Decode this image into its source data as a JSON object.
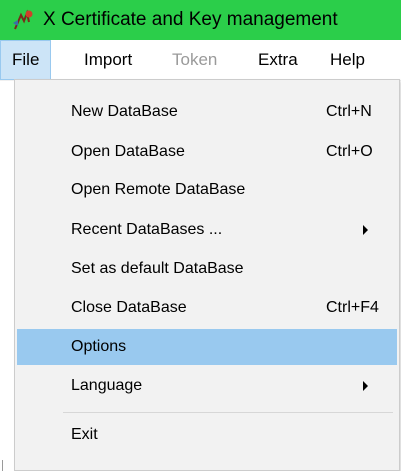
{
  "window": {
    "title": "X Certificate and Key management",
    "titlebar_color": "#2bce4a",
    "icon": "xca-app-icon"
  },
  "menubar": {
    "items": [
      {
        "label": "File",
        "state": "open"
      },
      {
        "label": "Import",
        "state": "normal"
      },
      {
        "label": "Token",
        "state": "disabled"
      },
      {
        "label": "Extra",
        "state": "normal"
      },
      {
        "label": "Help",
        "state": "normal"
      }
    ]
  },
  "file_menu": {
    "items": [
      {
        "label": "New DataBase",
        "shortcut": "Ctrl+N"
      },
      {
        "label": "Open DataBase",
        "shortcut": "Ctrl+O"
      },
      {
        "label": "Open Remote DataBase",
        "shortcut": ""
      },
      {
        "label": "Recent DataBases ...",
        "shortcut": "",
        "submenu": true
      },
      {
        "label": "Set as default DataBase",
        "shortcut": ""
      },
      {
        "label": "Close DataBase",
        "shortcut": "Ctrl+F4"
      },
      {
        "label": "Options",
        "shortcut": "",
        "highlighted": true
      },
      {
        "label": "Language",
        "shortcut": "",
        "submenu": true
      },
      {
        "label": "Exit",
        "shortcut": ""
      }
    ],
    "highlight_color": "#99c9ef"
  }
}
